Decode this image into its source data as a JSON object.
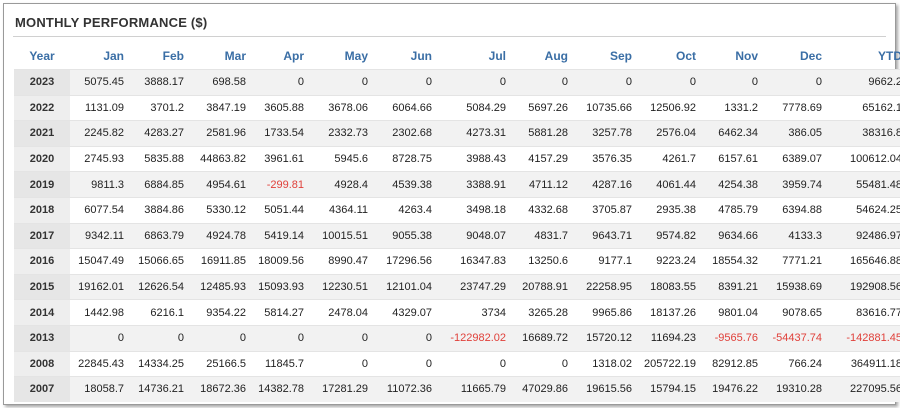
{
  "title": "MONTHLY PERFORMANCE ($)",
  "colors": {
    "header_text": "#3a6ea5",
    "negative": "#e0403a"
  },
  "columns": [
    "Year",
    "Jan",
    "Feb",
    "Mar",
    "Apr",
    "May",
    "Jun",
    "Jul",
    "Aug",
    "Sep",
    "Oct",
    "Nov",
    "Dec",
    "YTD"
  ],
  "rows": [
    {
      "year": "2023",
      "values": [
        "5075.45",
        "3888.17",
        "698.58",
        "0",
        "0",
        "0",
        "0",
        "0",
        "0",
        "0",
        "0",
        "0",
        "9662.2"
      ]
    },
    {
      "year": "2022",
      "values": [
        "1131.09",
        "3701.2",
        "3847.19",
        "3605.88",
        "3678.06",
        "6064.66",
        "5084.29",
        "5697.26",
        "10735.66",
        "12506.92",
        "1331.2",
        "7778.69",
        "65162.1"
      ]
    },
    {
      "year": "2021",
      "values": [
        "2245.82",
        "4283.27",
        "2581.96",
        "1733.54",
        "2332.73",
        "2302.68",
        "4273.31",
        "5881.28",
        "3257.78",
        "2576.04",
        "6462.34",
        "386.05",
        "38316.8"
      ]
    },
    {
      "year": "2020",
      "values": [
        "2745.93",
        "5835.88",
        "44863.82",
        "3961.61",
        "5945.6",
        "8728.75",
        "3988.43",
        "4157.29",
        "3576.35",
        "4261.7",
        "6157.61",
        "6389.07",
        "100612.04"
      ]
    },
    {
      "year": "2019",
      "values": [
        "9811.3",
        "6884.85",
        "4954.61",
        "-299.81",
        "4928.4",
        "4539.38",
        "3388.91",
        "4711.12",
        "4287.16",
        "4061.44",
        "4254.38",
        "3959.74",
        "55481.48"
      ]
    },
    {
      "year": "2018",
      "values": [
        "6077.54",
        "3884.86",
        "5330.12",
        "5051.44",
        "4364.11",
        "4263.4",
        "3498.18",
        "4332.68",
        "3705.87",
        "2935.38",
        "4785.79",
        "6394.88",
        "54624.25"
      ]
    },
    {
      "year": "2017",
      "values": [
        "9342.11",
        "6863.79",
        "4924.78",
        "5419.14",
        "10015.51",
        "9055.38",
        "9048.07",
        "4831.7",
        "9643.71",
        "9574.82",
        "9634.66",
        "4133.3",
        "92486.97"
      ]
    },
    {
      "year": "2016",
      "values": [
        "15047.49",
        "15066.65",
        "16911.85",
        "18009.56",
        "8990.47",
        "17296.56",
        "16347.83",
        "13250.6",
        "9177.1",
        "9223.24",
        "18554.32",
        "7771.21",
        "165646.88"
      ]
    },
    {
      "year": "2015",
      "values": [
        "19162.01",
        "12626.54",
        "12485.93",
        "15093.93",
        "12230.51",
        "12101.04",
        "23747.29",
        "20788.91",
        "22258.95",
        "18083.55",
        "8391.21",
        "15938.69",
        "192908.56"
      ]
    },
    {
      "year": "2014",
      "values": [
        "1442.98",
        "6216.1",
        "9354.22",
        "5814.27",
        "2478.04",
        "4329.07",
        "3734",
        "3265.28",
        "9965.86",
        "18137.26",
        "9801.04",
        "9078.65",
        "83616.77"
      ]
    },
    {
      "year": "2013",
      "values": [
        "0",
        "0",
        "0",
        "0",
        "0",
        "0",
        "-122982.02",
        "16689.72",
        "15720.12",
        "11694.23",
        "-9565.76",
        "-54437.74",
        "-142881.45"
      ]
    },
    {
      "year": "2008",
      "values": [
        "22845.43",
        "14334.25",
        "25166.5",
        "11845.7",
        "0",
        "0",
        "0",
        "0",
        "1318.02",
        "205722.19",
        "82912.85",
        "766.24",
        "364911.18"
      ]
    },
    {
      "year": "2007",
      "values": [
        "18058.7",
        "14736.21",
        "18672.36",
        "14382.78",
        "17281.29",
        "11072.36",
        "11665.79",
        "47029.86",
        "19615.56",
        "15794.15",
        "19476.22",
        "19310.28",
        "227095.56"
      ]
    }
  ]
}
